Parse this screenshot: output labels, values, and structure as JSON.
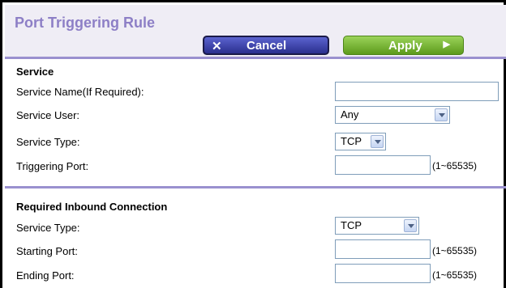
{
  "header": {
    "title": "Port Triggering Rule",
    "cancel_label": "Cancel",
    "apply_label": "Apply"
  },
  "service": {
    "section_title": "Service",
    "name_label": "Service Name(If Required):",
    "name_value": "",
    "user_label": "Service User:",
    "user_selected": "Any",
    "type_label": "Service Type:",
    "type_selected": "TCP",
    "trigger_label": "Triggering Port:",
    "trigger_value": "",
    "trigger_range": "(1~65535)"
  },
  "inbound": {
    "section_title": "Required Inbound Connection",
    "type_label": "Service Type:",
    "type_selected": "TCP",
    "start_label": "Starting Port:",
    "start_value": "",
    "start_range": "(1~65535)",
    "end_label": "Ending Port:",
    "end_value": "",
    "end_range": "(1~65535)"
  },
  "colors": {
    "title": "#8d7fc6",
    "divider": "#9a90cf",
    "cancel": "#3a40a8",
    "apply": "#7cbb35"
  },
  "icons": {
    "cancel": "close-icon",
    "apply": "play-arrow-icon",
    "dropdown": "chevron-down-icon"
  }
}
